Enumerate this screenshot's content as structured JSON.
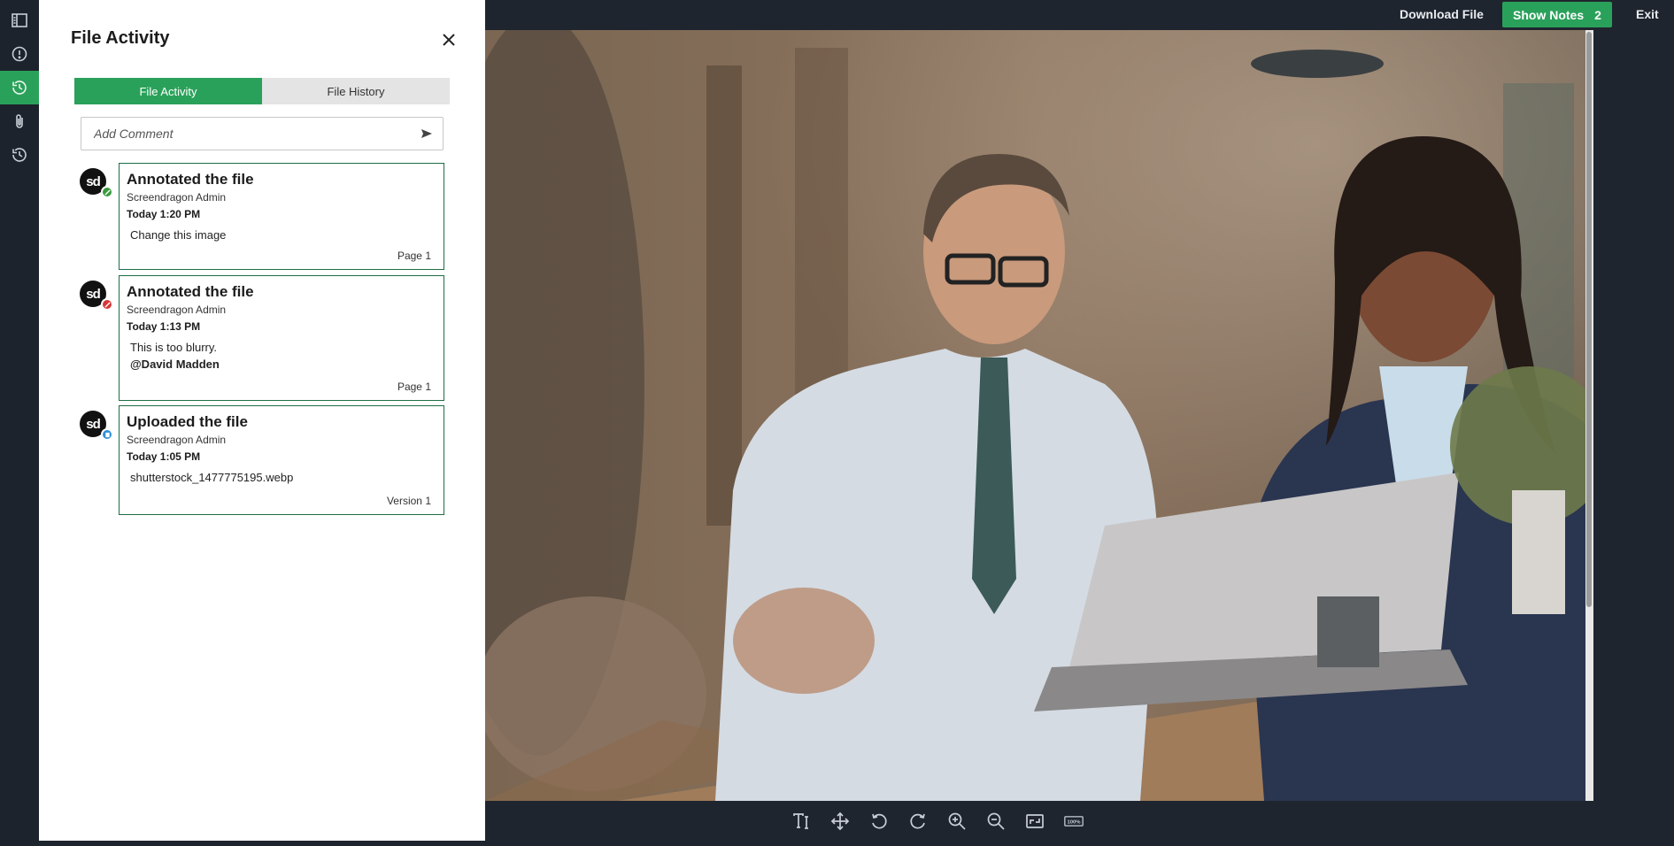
{
  "rail": {
    "items": [
      {
        "name": "sidebar-toggle-icon",
        "active": false
      },
      {
        "name": "info-icon",
        "active": false
      },
      {
        "name": "activity-clock-icon",
        "active": true
      },
      {
        "name": "attachment-icon",
        "active": false
      },
      {
        "name": "history-icon",
        "active": false
      }
    ]
  },
  "topbar": {
    "download_label": "Download File",
    "notes_label": "Show Notes",
    "notes_count": "2",
    "exit_label": "Exit"
  },
  "panel": {
    "title": "File Activity",
    "tabs": [
      {
        "label": "File Activity",
        "active": true
      },
      {
        "label": "File History",
        "active": false
      }
    ],
    "comment_placeholder": "Add Comment",
    "entries": [
      {
        "avatar": "sd",
        "badge_color": "#3a9a3c",
        "title": "Annotated the file",
        "user": "Screendragon Admin",
        "time": "Today 1:20 PM",
        "body": "Change this image",
        "mention": "",
        "footer": "Page 1"
      },
      {
        "avatar": "sd",
        "badge_color": "#d73737",
        "title": "Annotated the file",
        "user": "Screendragon Admin",
        "time": "Today 1:13 PM",
        "body": "This is too blurry.",
        "mention": "@David Madden",
        "footer": "Page 1"
      },
      {
        "avatar": "sd",
        "badge_color": "#2e8fd8",
        "title": "Uploaded the file",
        "user": "Screendragon Admin",
        "time": "Today 1:05 PM",
        "body": "shutterstock_1477775195.webp",
        "mention": "",
        "footer": "Version 1"
      }
    ]
  },
  "toolbar": {
    "tools": [
      "text-tool-icon",
      "move-icon",
      "rotate-left-icon",
      "rotate-right-icon",
      "zoom-in-icon",
      "zoom-out-icon",
      "fit-screen-icon",
      "actual-size-icon"
    ],
    "actual_size_label": "100%"
  },
  "colors": {
    "accent": "#2aa15a",
    "card_border": "#1d6e44",
    "background": "#1f252e"
  }
}
